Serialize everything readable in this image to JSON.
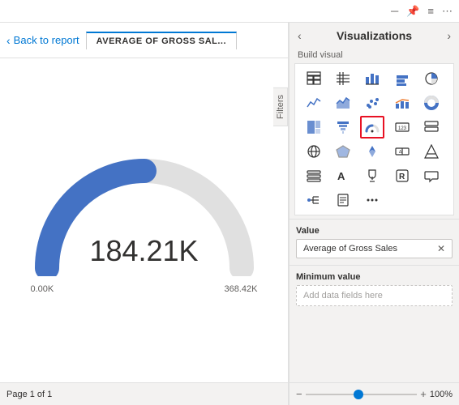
{
  "topbar": {
    "icons": [
      "─",
      "📌",
      "≡",
      "⋯"
    ]
  },
  "report": {
    "back_label": "Back to report",
    "tab_title": "AVERAGE OF GROSS SAL...",
    "filters_label": "Filters",
    "gauge_value": "184.21K",
    "gauge_min": "0.00K",
    "gauge_max": "368.42K",
    "page_label": "Page 1 of 1"
  },
  "panel": {
    "title": "Visualizations",
    "build_visual_label": "Build visual",
    "nav_prev": "‹",
    "nav_next": "›",
    "value_label": "Value",
    "value_field": "Average of Gross Sales",
    "min_value_label": "Minimum value",
    "min_placeholder": "Add data fields here",
    "icons_row1": [
      "▦",
      "🗂",
      "≣",
      "📊",
      "🍩"
    ],
    "icons_row2": [
      "📈",
      "⛰",
      "Ⓜ",
      "📉",
      "🥧"
    ],
    "icons_row3": [
      "▬",
      "🔽",
      "🕐",
      "⭕",
      "▣"
    ],
    "icons_row4": [
      "🌐",
      "🗺",
      "▶",
      "🌡",
      "123"
    ],
    "icons_row5": [
      "📋",
      "🃏",
      "🏆",
      "📊",
      "📍"
    ],
    "icons_row6": [
      "💬",
      "📄",
      "▯",
      "⋯",
      "◆"
    ],
    "zoom_label": "100%",
    "zoom_minus": "−",
    "zoom_plus": "+"
  }
}
